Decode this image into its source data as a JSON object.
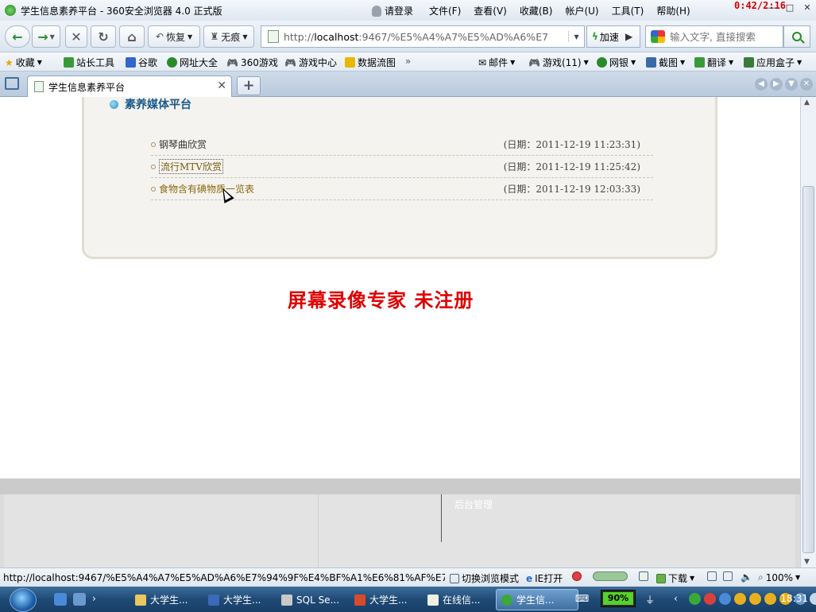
{
  "window": {
    "title": "学生信息素养平台 - 360安全浏览器 4.0 正式版",
    "login": "请登录",
    "menus": [
      "文件(F)",
      "查看(V)",
      "收藏(B)",
      "帐户(U)",
      "工具(T)",
      "帮助(H)"
    ],
    "recording": "0:42/2:16"
  },
  "toolbar": {
    "restore_label": "恢复",
    "incognito_label": "无痕",
    "address_prefix": "http://",
    "address_host": "localhost",
    "address_rest": ":9467/%E5%A4%A7%E5%AD%A6%E7",
    "speed_label": "加速",
    "search_placeholder": "输入文字, 直接搜索"
  },
  "favorites": {
    "collect": "收藏",
    "items": [
      "站长工具",
      "谷歌",
      "网址大全",
      "360游戏",
      "游戏中心",
      "数据流图"
    ],
    "right_items": [
      "邮件",
      "游戏(11)",
      "网银",
      "截图",
      "翻译",
      "应用盒子"
    ]
  },
  "tabs": [
    {
      "label": "学生信息素养平台"
    }
  ],
  "page": {
    "section_title": "素养媒体平台",
    "rows": [
      {
        "name": "钢琴曲欣赏",
        "date": "(日期：2011-12-19 11:23:31)"
      },
      {
        "name": "流行MTV欣赏",
        "date": "(日期：2011-12-19 11:25:42)"
      },
      {
        "name": "食物含有碘物质一览表",
        "date": "(日期：2011-12-19 12:03:33)"
      }
    ],
    "watermark": "屏幕录像专家  未注册",
    "footer_admin": "后台管理"
  },
  "statusbar": {
    "url": "http://localhost:9467/%E5%A4%A7%E5%AD%A6%E7%94%9F%E4%BF%A1%E6%81%AF%E7...",
    "switch_mode": "切换浏览模式",
    "ie_open": "IE打开",
    "download": "下载",
    "zoom": "100%"
  },
  "taskbar": {
    "tasks": [
      "大学生...",
      "大学生...",
      "SQL Se...",
      "大学生...",
      "在线信...",
      "学生信..."
    ],
    "battery": "90%",
    "clock": "18:31"
  }
}
